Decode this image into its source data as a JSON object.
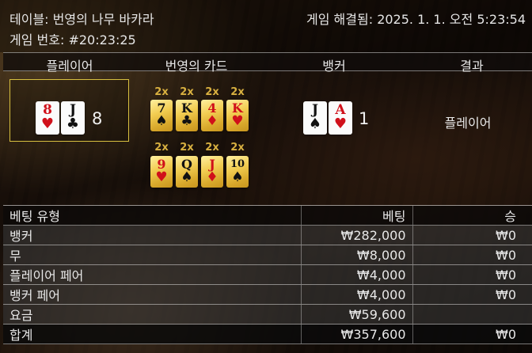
{
  "header": {
    "table_name": "테이블: 번영의 나무 바카라",
    "game_number": "게임 번호: #20:23:25",
    "resolved": "게임 해결됨: 2025. 1. 1. 오전 5:23:54"
  },
  "round": {
    "columns": [
      "플레이어",
      "번영의 카드",
      "뱅커",
      "결과"
    ],
    "player": {
      "cards": [
        {
          "rank": "8",
          "suit": "♥",
          "color": "red"
        },
        {
          "rank": "J",
          "suit": "♣",
          "color": "black"
        }
      ],
      "score": "8"
    },
    "banker": {
      "cards": [
        {
          "rank": "J",
          "suit": "♠",
          "color": "black"
        },
        {
          "rank": "A",
          "suit": "♥",
          "color": "red"
        }
      ],
      "score": "1"
    },
    "fortune_cards": [
      {
        "mult": "2x",
        "rank": "7",
        "suit": "♠",
        "color": "black"
      },
      {
        "mult": "2x",
        "rank": "K",
        "suit": "♣",
        "color": "black"
      },
      {
        "mult": "2x",
        "rank": "4",
        "suit": "♦",
        "color": "red"
      },
      {
        "mult": "2x",
        "rank": "K",
        "suit": "♥",
        "color": "red"
      },
      {
        "mult": "2x",
        "rank": "9",
        "suit": "♥",
        "color": "red"
      },
      {
        "mult": "2x",
        "rank": "Q",
        "suit": "♠",
        "color": "black"
      },
      {
        "mult": "2x",
        "rank": "J",
        "suit": "♦",
        "color": "red"
      },
      {
        "mult": "2x",
        "rank": "10",
        "suit": "♠",
        "color": "black"
      }
    ],
    "result": "플레이어"
  },
  "bets": {
    "headers": [
      "베팅 유형",
      "베팅",
      "승"
    ],
    "rows": [
      {
        "type": "뱅커",
        "bet": "₩282,000",
        "win": "₩0"
      },
      {
        "type": "무",
        "bet": "₩8,000",
        "win": "₩0"
      },
      {
        "type": "플레이어 페어",
        "bet": "₩4,000",
        "win": "₩0"
      },
      {
        "type": "뱅커 페어",
        "bet": "₩4,000",
        "win": "₩0"
      },
      {
        "type": "요금",
        "bet": "₩59,600",
        "win": ""
      }
    ],
    "total": {
      "type": "합계",
      "bet": "₩357,600",
      "win": "₩0"
    }
  }
}
